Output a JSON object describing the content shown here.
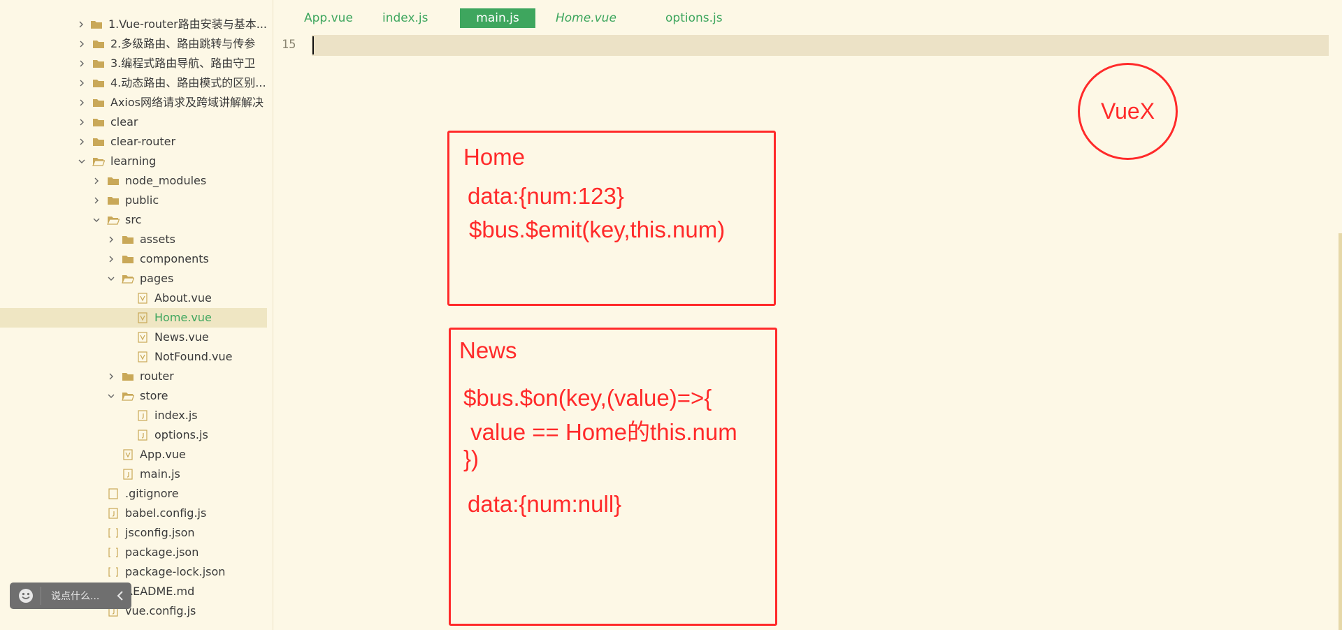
{
  "sidebar": {
    "items": [
      {
        "label": "1.Vue-router路由安装与基本...",
        "type": "folder",
        "state": "collapsed"
      },
      {
        "label": "2.多级路由、路由跳转与传参",
        "type": "folder",
        "state": "collapsed"
      },
      {
        "label": "3.编程式路由导航、路由守卫",
        "type": "folder",
        "state": "collapsed"
      },
      {
        "label": "4.动态路由、路由模式的区别...",
        "type": "folder",
        "state": "collapsed"
      },
      {
        "label": "Axios网络请求及跨域讲解解决",
        "type": "folder",
        "state": "collapsed"
      },
      {
        "label": "clear",
        "type": "folder",
        "state": "collapsed"
      },
      {
        "label": "clear-router",
        "type": "folder",
        "state": "collapsed"
      },
      {
        "label": "learning",
        "type": "folder",
        "state": "expanded"
      },
      {
        "label": "node_modules",
        "type": "folder",
        "state": "collapsed"
      },
      {
        "label": "public",
        "type": "folder",
        "state": "collapsed"
      },
      {
        "label": "src",
        "type": "folder",
        "state": "expanded"
      },
      {
        "label": "assets",
        "type": "folder",
        "state": "collapsed"
      },
      {
        "label": "components",
        "type": "folder",
        "state": "collapsed"
      },
      {
        "label": "pages",
        "type": "folder",
        "state": "expanded"
      },
      {
        "label": "About.vue",
        "type": "vue"
      },
      {
        "label": "Home.vue",
        "type": "vue",
        "selected": true
      },
      {
        "label": "News.vue",
        "type": "vue"
      },
      {
        "label": "NotFound.vue",
        "type": "vue"
      },
      {
        "label": "router",
        "type": "folder",
        "state": "collapsed"
      },
      {
        "label": "store",
        "type": "folder",
        "state": "expanded"
      },
      {
        "label": "index.js",
        "type": "js"
      },
      {
        "label": "options.js",
        "type": "js"
      },
      {
        "label": "App.vue",
        "type": "vue"
      },
      {
        "label": "main.js",
        "type": "js"
      },
      {
        "label": ".gitignore",
        "type": "file"
      },
      {
        "label": "babel.config.js",
        "type": "js"
      },
      {
        "label": "jsconfig.json",
        "type": "json"
      },
      {
        "label": "package.json",
        "type": "json"
      },
      {
        "label": "package-lock.json",
        "type": "json"
      },
      {
        "label": "README.md",
        "type": "md"
      },
      {
        "label": "vue.config.js",
        "type": "js"
      }
    ],
    "chat_placeholder": "说点什么..."
  },
  "tabs": [
    {
      "label": "App.vue"
    },
    {
      "label": "index.js"
    },
    {
      "label": "main.js",
      "active": true
    },
    {
      "label": "Home.vue",
      "italic": true
    },
    {
      "label": "options.js"
    }
  ],
  "editor": {
    "line_number": "15"
  },
  "annotations": {
    "vuex": "VueX",
    "home_title": "Home",
    "home_line1": "data:{num:123}",
    "home_line2": "$bus.$emit(key,this.num)",
    "news_title": "News",
    "news_line1": "$bus.$on(key,(value)=>{",
    "news_line2": " value == Home的this.num",
    "news_line3": "})",
    "news_line4": "data:{num:null}"
  },
  "colors": {
    "background": "#fdf8e6",
    "accent": "#3ea65e",
    "annotation": "#ff2a2a",
    "folder": "#c9a858"
  }
}
